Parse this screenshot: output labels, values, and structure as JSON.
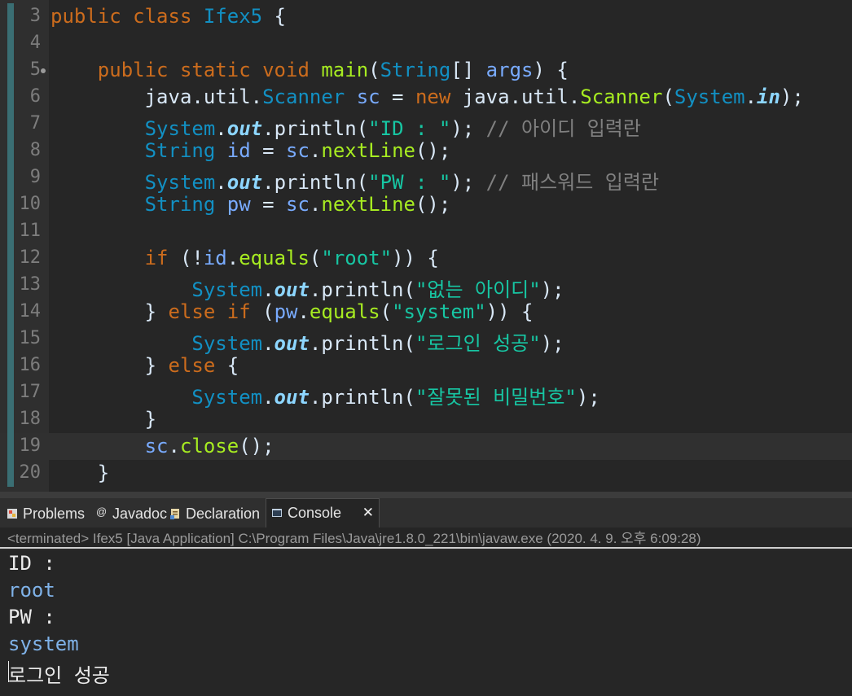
{
  "editor": {
    "lines": [
      {
        "n": "3",
        "segs": [
          [
            "kw",
            "public"
          ],
          [
            "pl",
            " "
          ],
          [
            "kw",
            "class"
          ],
          [
            "pl",
            " "
          ],
          [
            "ty",
            "Ifex5"
          ],
          [
            "pl",
            " {"
          ]
        ]
      },
      {
        "n": "4",
        "segs": []
      },
      {
        "n": "5",
        "fold": true,
        "segs": [
          [
            "pl",
            "    "
          ],
          [
            "kw",
            "public"
          ],
          [
            "pl",
            " "
          ],
          [
            "kw",
            "static"
          ],
          [
            "pl",
            " "
          ],
          [
            "kw",
            "void"
          ],
          [
            "pl",
            " "
          ],
          [
            "fn",
            "main"
          ],
          [
            "pl",
            "("
          ],
          [
            "ty",
            "String"
          ],
          [
            "pl",
            "[] "
          ],
          [
            "pm",
            "args"
          ],
          [
            "pl",
            ") {"
          ]
        ]
      },
      {
        "n": "6",
        "segs": [
          [
            "pl",
            "        java.util."
          ],
          [
            "ty",
            "Scanner"
          ],
          [
            "pl",
            " "
          ],
          [
            "pm",
            "sc"
          ],
          [
            "pl",
            " = "
          ],
          [
            "kw",
            "new"
          ],
          [
            "pl",
            " java.util."
          ],
          [
            "fn",
            "Scanner"
          ],
          [
            "pl",
            "("
          ],
          [
            "ty",
            "System"
          ],
          [
            "pl",
            "."
          ],
          [
            "fi",
            "in"
          ],
          [
            "pl",
            ");"
          ]
        ]
      },
      {
        "n": "7",
        "segs": [
          [
            "pl",
            "        "
          ],
          [
            "ty",
            "System"
          ],
          [
            "pl",
            "."
          ],
          [
            "fi",
            "out"
          ],
          [
            "pl",
            "."
          ],
          [
            "pl",
            "println"
          ],
          [
            "pl",
            "("
          ],
          [
            "st",
            "\"ID : \""
          ],
          [
            "pl",
            ");"
          ],
          [
            "cm",
            " // 아이디 입력란"
          ]
        ]
      },
      {
        "n": "8",
        "segs": [
          [
            "pl",
            "        "
          ],
          [
            "ty",
            "String"
          ],
          [
            "pl",
            " "
          ],
          [
            "pm",
            "id"
          ],
          [
            "pl",
            " = "
          ],
          [
            "pm",
            "sc"
          ],
          [
            "pl",
            "."
          ],
          [
            "fn",
            "nextLine"
          ],
          [
            "pl",
            "();"
          ]
        ]
      },
      {
        "n": "9",
        "segs": [
          [
            "pl",
            "        "
          ],
          [
            "ty",
            "System"
          ],
          [
            "pl",
            "."
          ],
          [
            "fi",
            "out"
          ],
          [
            "pl",
            "."
          ],
          [
            "pl",
            "println"
          ],
          [
            "pl",
            "("
          ],
          [
            "st",
            "\"PW : \""
          ],
          [
            "pl",
            ");"
          ],
          [
            "cm",
            " // 패스워드 입력란"
          ]
        ]
      },
      {
        "n": "10",
        "segs": [
          [
            "pl",
            "        "
          ],
          [
            "ty",
            "String"
          ],
          [
            "pl",
            " "
          ],
          [
            "pm",
            "pw"
          ],
          [
            "pl",
            " = "
          ],
          [
            "pm",
            "sc"
          ],
          [
            "pl",
            "."
          ],
          [
            "fn",
            "nextLine"
          ],
          [
            "pl",
            "();"
          ]
        ]
      },
      {
        "n": "11",
        "segs": []
      },
      {
        "n": "12",
        "segs": [
          [
            "pl",
            "        "
          ],
          [
            "kw",
            "if"
          ],
          [
            "pl",
            " (!"
          ],
          [
            "pm",
            "id"
          ],
          [
            "pl",
            "."
          ],
          [
            "fn",
            "equals"
          ],
          [
            "pl",
            "("
          ],
          [
            "st",
            "\"root\""
          ],
          [
            "pl",
            ")) {"
          ]
        ]
      },
      {
        "n": "13",
        "segs": [
          [
            "pl",
            "            "
          ],
          [
            "ty",
            "System"
          ],
          [
            "pl",
            "."
          ],
          [
            "fi",
            "out"
          ],
          [
            "pl",
            "."
          ],
          [
            "pl",
            "println"
          ],
          [
            "pl",
            "("
          ],
          [
            "st",
            "\"없는 아이디\""
          ],
          [
            "pl",
            ");"
          ]
        ]
      },
      {
        "n": "14",
        "segs": [
          [
            "pl",
            "        } "
          ],
          [
            "kw",
            "else"
          ],
          [
            "pl",
            " "
          ],
          [
            "kw",
            "if"
          ],
          [
            "pl",
            " ("
          ],
          [
            "pm",
            "pw"
          ],
          [
            "pl",
            "."
          ],
          [
            "fn",
            "equals"
          ],
          [
            "pl",
            "("
          ],
          [
            "st",
            "\"system\""
          ],
          [
            "pl",
            ")) {"
          ]
        ]
      },
      {
        "n": "15",
        "segs": [
          [
            "pl",
            "            "
          ],
          [
            "ty",
            "System"
          ],
          [
            "pl",
            "."
          ],
          [
            "fi",
            "out"
          ],
          [
            "pl",
            "."
          ],
          [
            "pl",
            "println"
          ],
          [
            "pl",
            "("
          ],
          [
            "st",
            "\"로그인 성공\""
          ],
          [
            "pl",
            ");"
          ]
        ]
      },
      {
        "n": "16",
        "segs": [
          [
            "pl",
            "        } "
          ],
          [
            "kw",
            "else"
          ],
          [
            "pl",
            " {"
          ]
        ]
      },
      {
        "n": "17",
        "segs": [
          [
            "pl",
            "            "
          ],
          [
            "ty",
            "System"
          ],
          [
            "pl",
            "."
          ],
          [
            "fi",
            "out"
          ],
          [
            "pl",
            "."
          ],
          [
            "pl",
            "println"
          ],
          [
            "pl",
            "("
          ],
          [
            "st",
            "\"잘못된 비밀번호\""
          ],
          [
            "pl",
            ");"
          ]
        ]
      },
      {
        "n": "18",
        "segs": [
          [
            "pl",
            "        }"
          ]
        ]
      },
      {
        "n": "19",
        "current": true,
        "segs": [
          [
            "pl",
            "        "
          ],
          [
            "pm",
            "sc"
          ],
          [
            "pl",
            "."
          ],
          [
            "fn",
            "close"
          ],
          [
            "pl",
            "();"
          ]
        ]
      },
      {
        "n": "20",
        "segs": [
          [
            "pl",
            "    }"
          ]
        ]
      }
    ]
  },
  "tabs": {
    "problems": "Problems",
    "javadoc": "Javadoc",
    "declaration": "Declaration",
    "console": "Console",
    "close_glyph": "✕"
  },
  "console": {
    "status": "<terminated> Ifex5 [Java Application] C:\\Program Files\\Java\\jre1.8.0_221\\bin\\javaw.exe (2020. 4. 9. 오후 6:09:28)",
    "lines": [
      {
        "kind": "out",
        "text": "ID :"
      },
      {
        "kind": "in",
        "text": "root"
      },
      {
        "kind": "out",
        "text": "PW :"
      },
      {
        "kind": "in",
        "text": "system"
      },
      {
        "kind": "out",
        "text": "로그인 성공"
      }
    ]
  },
  "colors": {
    "keyword": "#cc6c1d",
    "type": "#1290c3",
    "method": "#a7ec21",
    "variable": "#79abff",
    "string": "#17c6a3",
    "comment": "#808080",
    "field": "#8dd6ff",
    "plain": "#d9e8f7",
    "console_input": "#7fb2e8",
    "console_output": "#ebebeb"
  },
  "icons": {
    "problems": "problems-icon",
    "javadoc": "javadoc-icon",
    "declaration": "declaration-icon",
    "console": "console-icon"
  }
}
